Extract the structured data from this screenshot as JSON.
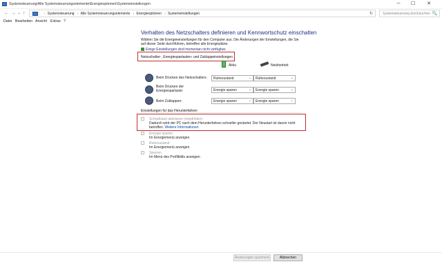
{
  "window": {
    "title": "Systemsteuerung\\Alle Systemsteuerungselemente\\Energieoptionen\\Systemeinstellungen",
    "minimize": "─",
    "maximize": "☐",
    "close": "✕"
  },
  "nav": {
    "back": "←",
    "forward": "→",
    "up": "↑",
    "dropdown": "⌄",
    "refresh": "↻"
  },
  "breadcrumb": [
    "Systemsteuerung",
    "Alle Systemsteuerungselemente",
    "Energieoptionen",
    "Systemeinstellungen"
  ],
  "breadcrumb_sep": "›",
  "search": {
    "placeholder": "Systemsteuerung durchsuchen",
    "icon": "🔍"
  },
  "menu": [
    "Datei",
    "Bearbeiten",
    "Ansicht",
    "Extras",
    "?"
  ],
  "main": {
    "heading": "Verhalten des Netzschalters definieren und Kennwortschutz einschalten",
    "intro": "Wählen Sie die Energieeinstellungen für den Computer aus. Die Änderungen der Einstellungen, die Sie auf dieser Seite durchführen, betreffen alle Energiepläne.",
    "notice_link": "Einige Einstellungen sind momentan nicht verfügbar.",
    "section_buttons": "Netzschalter-, Energiespartasten- und Zuklappeinstellungen",
    "col_battery": "Akku",
    "col_ac": "Netzbetrieb",
    "rows": [
      {
        "label": "Beim Drücken des Netzschalters:",
        "battery": "Ruhezustand",
        "ac": "Ruhezustand"
      },
      {
        "label": "Beim Drücken der Energiespartaste:",
        "battery": "Energie sparen",
        "ac": "Energie sparen"
      },
      {
        "label": "Beim Zuklappen:",
        "battery": "Energie sparen",
        "ac": "Energie sparen"
      }
    ],
    "section_shutdown": "Einstellungen für das Herunterfahren",
    "options": [
      {
        "label": "Schnellstart aktivieren (empfohlen)",
        "desc": "Dadurch wird der PC nach dem Herunterfahren schneller gestartet. Der Neustart ist davon nicht betroffen.",
        "link": "Weitere Informationen"
      },
      {
        "label": "Energie sparen",
        "desc": "Im Energiemenü anzeigen"
      },
      {
        "label": "Ruhezustand",
        "desc": "Im Energiemenü anzeigen"
      },
      {
        "label": "Sperren",
        "desc": "Im Menü des Profilbilds anzeigen"
      }
    ]
  },
  "footer": {
    "save": "Änderungen speichern",
    "cancel": "Abbrechen"
  }
}
